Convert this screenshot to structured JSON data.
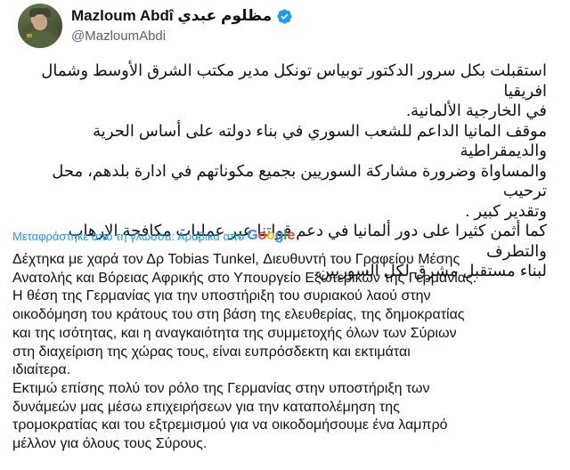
{
  "author": {
    "display_name": "Mazloum Abdî مظلوم عبدي",
    "handle": "@MazloumAbdi"
  },
  "tweet": {
    "arabic_lines": [
      "استقبلت بكل سرور الدكتور توبياس تونكل مدير مكتب الشرق الأوسط وشمال افريقيا",
      "في الخارجية الألمانية.",
      "موقف المانيا الداعم للشعب السوري في بناء دولته على أساس الحرية والديمقراطية",
      "والمساواة وضرورة مشاركة السوريين بجميع مكوناتهم في ادارة بلدهم، محل ترحيب",
      "وتقدير كبير .",
      "كما أثمن كثيرا على دور ألمانيا في دعم قواتنا عبر عمليات مكافحة الإرهاب والتطرف",
      "لبناء مستقبل مشرق لكل السوريين."
    ],
    "translate_label": "Μεταφράστηκε από τη γλώσσα: Αραβικά από",
    "translate_provider_letters": [
      "G",
      "o",
      "o",
      "g",
      "l",
      "e"
    ],
    "greek_lines": [
      "Δέχτηκα με χαρά τον Δρ Tobias Tunkel, Διευθυντή του Γραφείου Μέσης",
      "Ανατολής και Βόρειας Αφρικής στο Υπουργείο Εξωτερικών της Γερμανίας.",
      "Η θέση της Γερμανίας για την υποστήριξη του συριακού λαού στην",
      "οικοδόμηση του κράτους του στη βάση της ελευθερίας, της δημοκρατίας",
      "και της ισότητας, και η αναγκαιότητα της συμμετοχής όλων των Σύριων",
      "στη διαχείριση της χώρας τους, είναι ευπρόσδεκτη και εκτιμάται",
      "ιδιαίτερα.",
      "Εκτιμώ επίσης πολύ τον ρόλο της Γερμανίας στην υποστήριξη των",
      "δυνάμεών μας μέσω επιχειρήσεων για την καταπολέμηση της",
      "τρομοκρατίας και του εξτρεμισμού για να οικοδομήσουμε ένα λαμπρό",
      "μέλλον για όλους τους Σύρους."
    ]
  },
  "icons": {
    "verified": "verified-badge-icon",
    "avatar": "profile-photo"
  },
  "colors": {
    "link": "#1d9bf0",
    "text": "#0f1419",
    "secondary": "#536471",
    "verified": "#1d9bf0"
  }
}
